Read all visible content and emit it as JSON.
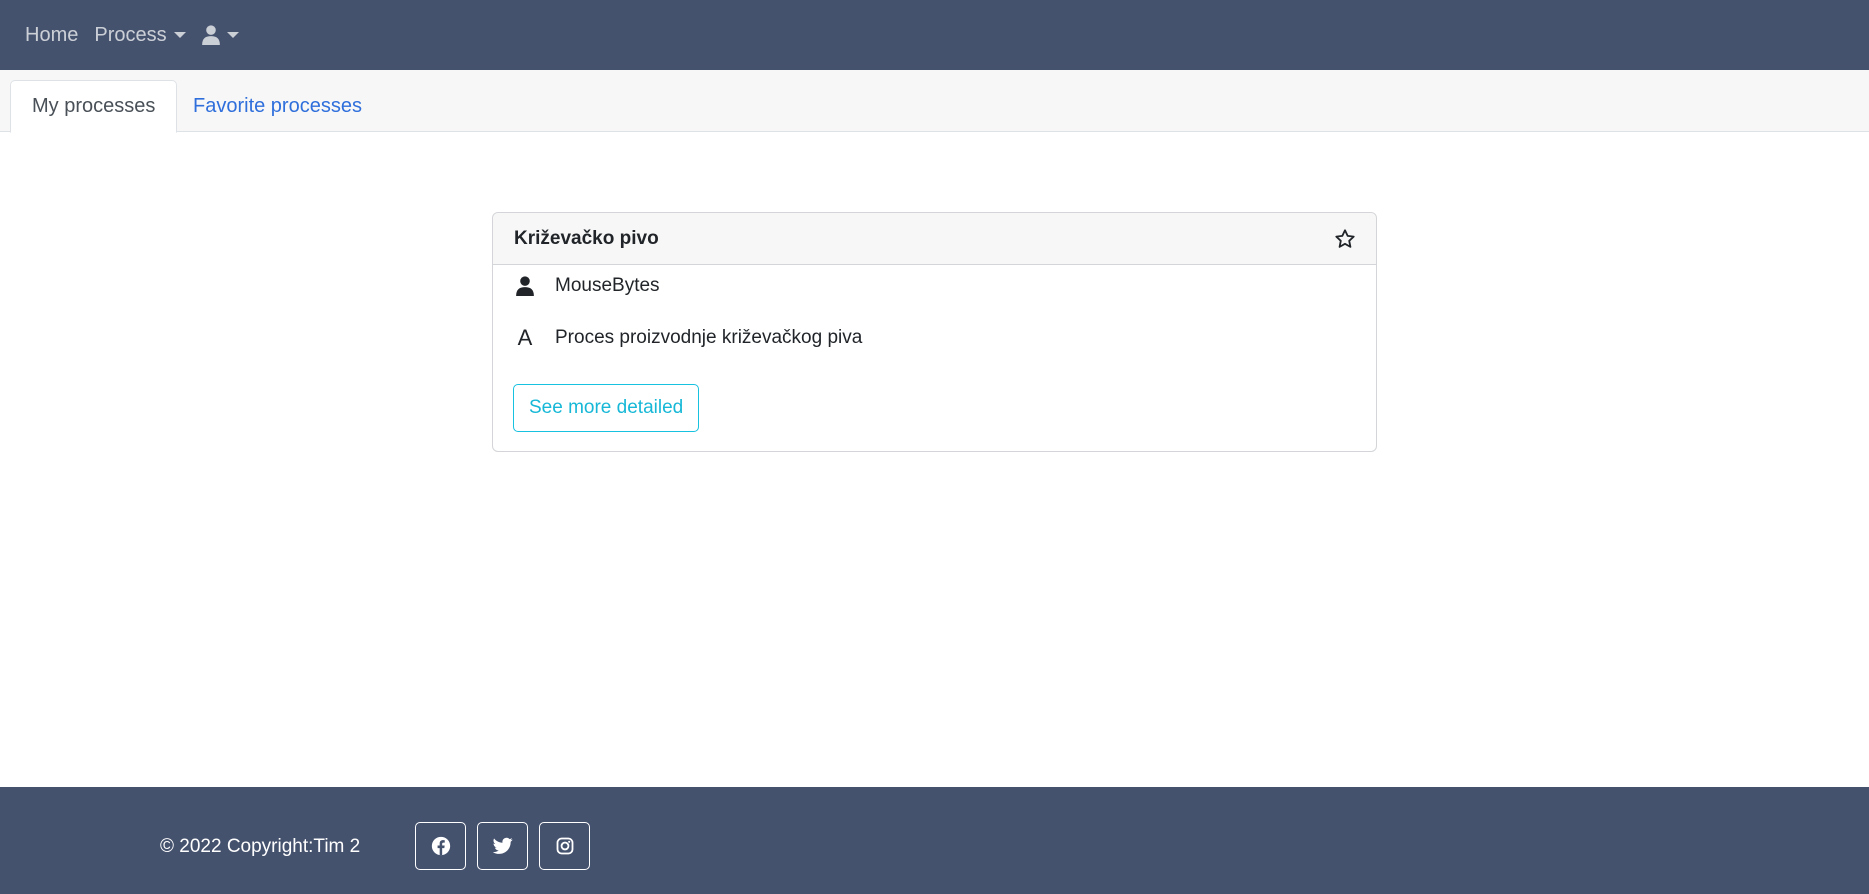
{
  "navbar": {
    "home": "Home",
    "process": "Process",
    "user_icon": "user-icon"
  },
  "tabs": [
    {
      "label": "My processes",
      "active": true
    },
    {
      "label": "Favorite processes",
      "active": false
    }
  ],
  "card": {
    "title": "Križevačko pivo",
    "favorite_icon": "star-outline-icon",
    "author_icon": "user-icon",
    "author": "MouseBytes",
    "description_icon": "letter-a-icon",
    "description_glyph": "A",
    "description": "Proces proizvodnje križevačkog piva",
    "button_label": "See more detailed"
  },
  "footer": {
    "copyright": "© 2022 Copyright:Tim 2",
    "social": [
      "facebook-icon",
      "twitter-icon",
      "instagram-icon"
    ]
  },
  "colors": {
    "navbar_bg": "#45526e",
    "tab_link": "#2f6fdc",
    "button_accent": "#17c1e0"
  }
}
